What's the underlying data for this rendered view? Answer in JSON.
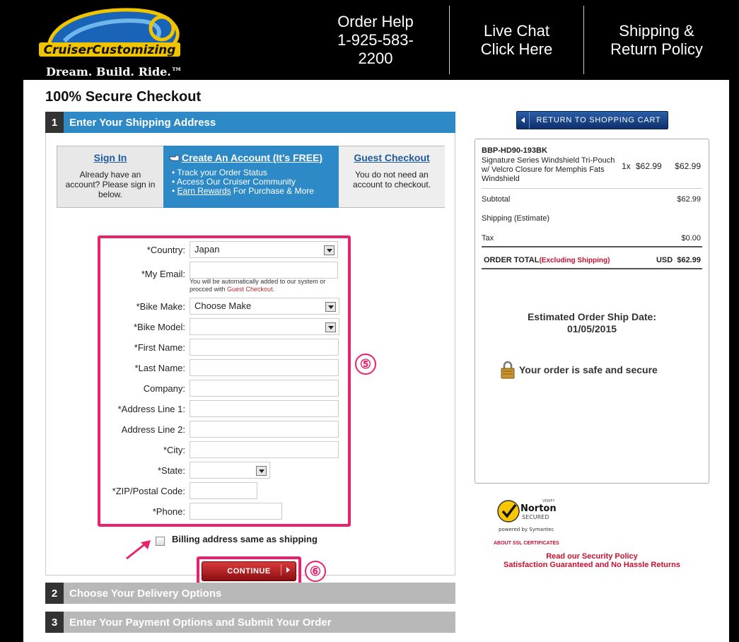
{
  "header": {
    "logo_text": "CruiserCustomizing",
    "tagline": "Dream. Build. Ride.™",
    "order_help_line1": "Order Help",
    "order_help_line2": "1-925-583-",
    "order_help_line3": "2200",
    "live_chat_line1": "Live Chat",
    "live_chat_line2": "Click Here",
    "shipping_line1": "Shipping &",
    "shipping_line2": "Return Policy"
  },
  "page_title": "100% Secure Checkout",
  "step1": {
    "num": "1",
    "title": "Enter Your Shipping Address",
    "tabs": {
      "signin": {
        "title": "Sign In",
        "text": "Already have an account? Please sign in below."
      },
      "create": {
        "title": "Create An Account",
        "free": "(It's FREE)",
        "bullets": [
          "Track your Order Status",
          "Access Our Cruiser Community"
        ],
        "rewards_link": "Earn Rewards",
        "rewards_rest": " For Purchase & More"
      },
      "guest": {
        "title": "Guest Checkout",
        "text": "You do not need an account to checkout."
      }
    },
    "form": {
      "country_label": "*Country:",
      "country_value": "Japan",
      "email_label": "*My Email:",
      "email_value": "",
      "email_note": "You will be automatically added to our system or procced with ",
      "email_note_link": "Guest Checkout",
      "email_note_end": ".",
      "bike_make_label": "*Bike Make:",
      "bike_make_value": "Choose Make",
      "bike_model_label": "*Bike Model:",
      "bike_model_value": "",
      "first_name_label": "*First Name:",
      "last_name_label": "*Last Name:",
      "company_label": "Company:",
      "address1_label": "*Address Line 1:",
      "address2_label": "Address Line 2:",
      "city_label": "*City:",
      "state_label": "*State:",
      "state_value": "",
      "zip_label": "*ZIP/Postal Code:",
      "phone_label": "*Phone:"
    },
    "annotation_5": "⑤",
    "billing_label": "Billing address same as shipping",
    "continue_label": "CONTINUE",
    "annotation_6": "⑥"
  },
  "step2": {
    "num": "2",
    "title": "Choose Your Delivery Options"
  },
  "step3": {
    "num": "3",
    "title": "Enter Your Payment Options and Submit Your Order"
  },
  "sidebar": {
    "return_cart": "RETURN TO SHOPPING CART",
    "item": {
      "sku": "BBP-HD90-193BK",
      "desc": "Signature Series Windshield Tri-Pouch w/ Velcro Closure for Memphis Fats Windshield",
      "qty": "1x",
      "price": "$62.99",
      "total": "$62.99"
    },
    "subtotal_label": "Subtotal",
    "subtotal_value": "$62.99",
    "shipping_label": "Shipping (Estimate)",
    "tax_label": "Tax",
    "tax_value": "$0.00",
    "order_total_label": "ORDER TOTAL",
    "order_total_note": "(Excluding Shipping)",
    "order_total_currency": "USD",
    "order_total_value": "$62.99",
    "ship_date_label": "Estimated Order Ship Date:",
    "ship_date_value": "01/05/2015",
    "safe_text": "Your order is safe and secure",
    "norton_verify": "VERIFY",
    "norton_name": "Norton",
    "norton_secured": "SECURED",
    "norton_powered": "powered by Symantec",
    "ssl_link": "ABOUT SSL CERTIFICATES",
    "security_policy": "Read our Security Policy",
    "satisfaction": "Satisfaction Guaranteed and No Hassle Returns"
  },
  "colors": {
    "accent_blue": "#2e8ac7",
    "highlight_pink": "#e8226c",
    "link_red": "#c8102e"
  }
}
